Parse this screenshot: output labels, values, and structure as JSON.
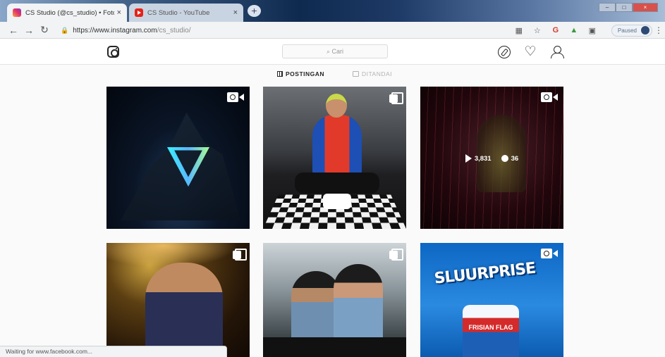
{
  "browser": {
    "tabs": [
      {
        "title": "CS Studio (@cs_studio) • Foto d…",
        "close": "×",
        "favicon": "instagram-icon"
      },
      {
        "title": "CS Studio - YouTube",
        "close": "×",
        "favicon": "youtube-icon"
      }
    ],
    "new_tab": "+",
    "window_controls": [
      "–",
      "□",
      "×"
    ],
    "address": {
      "host": "https://www.instagram.com",
      "path": "/cs_studio/"
    },
    "profile_status": "Paused",
    "profile_initial": "P"
  },
  "instagram": {
    "search_placeholder": "⌕ Cari",
    "profile_tabs": {
      "posts": "POSTINGAN",
      "tagged": "DITANDAI"
    },
    "posts": [
      {
        "type": "video"
      },
      {
        "type": "carousel"
      },
      {
        "type": "video",
        "views": "3,831",
        "comments": "36"
      },
      {
        "type": "carousel"
      },
      {
        "type": "carousel"
      },
      {
        "type": "video",
        "brand_text": "SLUURPRISE",
        "carton_text": "FRISIAN FLAG"
      }
    ]
  },
  "status_bar": "Waiting for www.facebook.com..."
}
